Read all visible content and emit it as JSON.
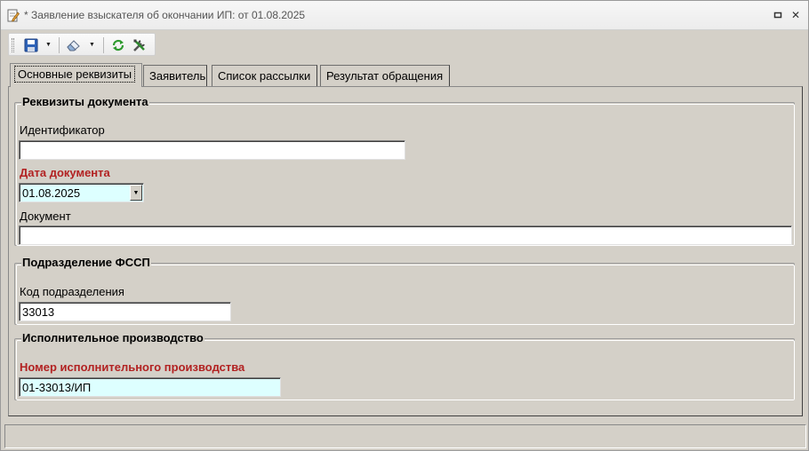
{
  "window": {
    "title": "* Заявление взыскателя об окончании ИП: от 01.08.2025",
    "restore_glyph": "▫",
    "close_glyph": "✕"
  },
  "toolbar": {
    "icons": [
      "save-icon",
      "eraser-icon",
      "refresh-icon",
      "tools-icon"
    ]
  },
  "tabs": [
    {
      "label": "Основные реквизиты",
      "active": true
    },
    {
      "label": "Заявитель",
      "active": false
    },
    {
      "label": "Список рассылки",
      "active": false
    },
    {
      "label": "Результат обращения",
      "active": false
    }
  ],
  "groups": {
    "doc": {
      "title": "Реквизиты документа",
      "identifier_label": "Идентификатор",
      "identifier_value": "",
      "date_label": "Дата документа",
      "date_value": "01.08.2025",
      "document_label": "Документ",
      "document_value": ""
    },
    "fssp": {
      "title": "Подразделение ФССП",
      "code_label": "Код подразделения",
      "code_value": "33013"
    },
    "ip": {
      "title": "Исполнительное производство",
      "number_label": "Номер исполнительного производства",
      "number_value": "01-33013/ИП"
    }
  },
  "colors": {
    "required_label": "#b22222",
    "required_field_bg": "#ddffff",
    "window_bg": "#d4d0c8"
  }
}
